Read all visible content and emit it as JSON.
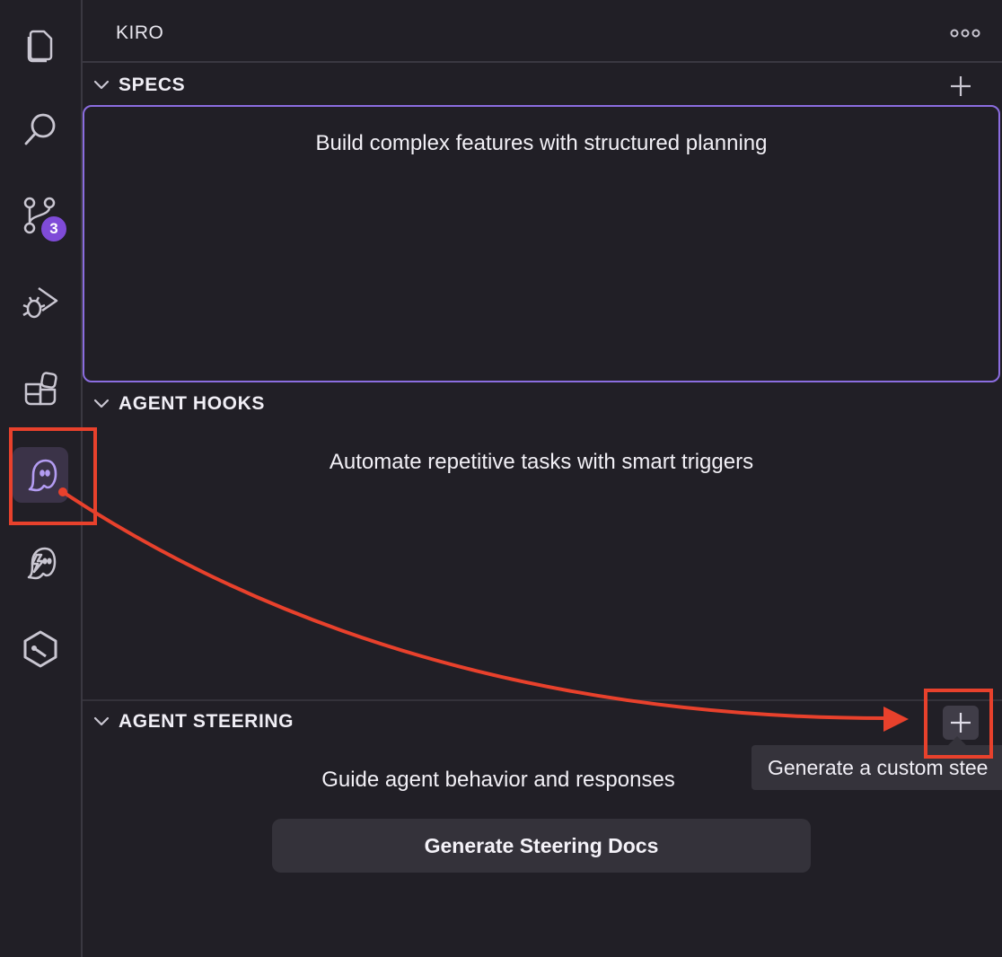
{
  "panel": {
    "title": "KIRO"
  },
  "activity_bar": {
    "items": [
      {
        "icon": "explorer-icon"
      },
      {
        "icon": "search-icon"
      },
      {
        "icon": "source-control-icon",
        "badge": "3"
      },
      {
        "icon": "run-debug-icon"
      },
      {
        "icon": "extensions-icon"
      },
      {
        "icon": "kiro-ghost-icon",
        "active": true
      },
      {
        "icon": "kiro-hooks-icon"
      },
      {
        "icon": "remote-hex-icon"
      }
    ]
  },
  "sections": {
    "specs": {
      "title": "SPECS",
      "description": "Build complex features with structured planning"
    },
    "hooks": {
      "title": "AGENT HOOKS",
      "description": "Automate repetitive tasks with smart triggers"
    },
    "steering": {
      "title": "AGENT STEERING",
      "description": "Guide agent behavior and responses",
      "button_label": "Generate Steering Docs",
      "add_tooltip": "Generate a custom stee"
    }
  },
  "colors": {
    "background": "#211f26",
    "accent": "#8b6de0",
    "badge": "#7f4bd8",
    "annotation": "#e8412c"
  }
}
